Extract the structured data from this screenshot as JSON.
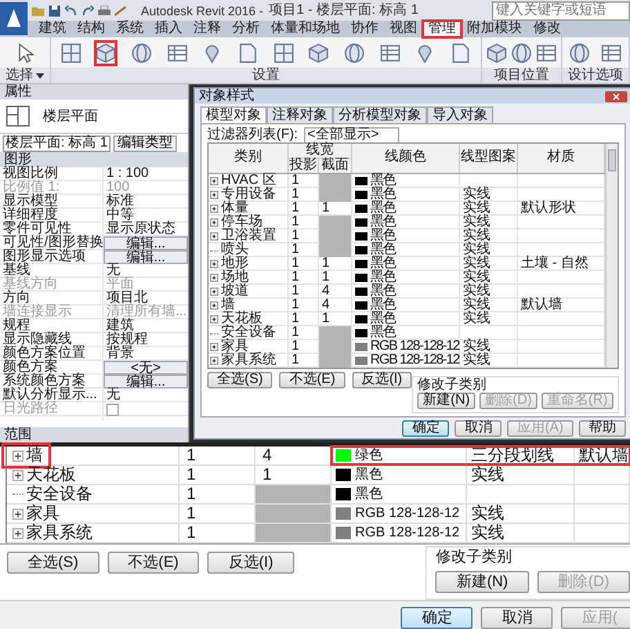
{
  "title_bar": {
    "app": "Autodesk Revit 2016 -",
    "document": "项目1 - 楼层平面: 标高 1",
    "search": {
      "placeholder": "键入关键字或短语"
    }
  },
  "ribbon_tabs": [
    {
      "label": "建筑",
      "selected": false,
      "annotated": false
    },
    {
      "label": "结构",
      "selected": false,
      "annotated": false
    },
    {
      "label": "系统",
      "selected": false,
      "annotated": false
    },
    {
      "label": "插入",
      "selected": false,
      "annotated": false
    },
    {
      "label": "注释",
      "selected": false,
      "annotated": false
    },
    {
      "label": "分析",
      "selected": false,
      "annotated": false
    },
    {
      "label": "体量和场地",
      "selected": false,
      "annotated": false
    },
    {
      "label": "协作",
      "selected": false,
      "annotated": false
    },
    {
      "label": "视图",
      "selected": false,
      "annotated": false
    },
    {
      "label": "管理",
      "selected": true,
      "annotated": true
    },
    {
      "label": "附加模块",
      "selected": false,
      "annotated": false
    },
    {
      "label": "修改",
      "selected": false,
      "annotated": false
    }
  ],
  "ribbon_groups": [
    {
      "label": "选择",
      "dropdown": true,
      "buttons": [
        {
          "annotated": false
        }
      ]
    },
    {
      "label": "设置",
      "dropdown": false,
      "buttons": [
        {
          "annotated": false
        },
        {
          "annotated": true
        },
        {
          "annotated": false
        },
        {
          "annotated": false
        },
        {
          "annotated": false
        },
        {
          "annotated": false
        },
        {
          "annotated": false
        },
        {
          "annotated": false
        },
        {
          "annotated": false
        },
        {
          "annotated": false
        },
        {
          "annotated": false
        },
        {
          "annotated": false
        }
      ]
    },
    {
      "label": "项目位置",
      "dropdown": false,
      "buttons": [
        {
          "annotated": false
        },
        {
          "annotated": false
        },
        {
          "annotated": false
        }
      ]
    },
    {
      "label": "设计选项",
      "dropdown": false,
      "buttons": [
        {
          "annotated": false
        },
        {
          "annotated": false
        }
      ]
    }
  ],
  "properties": {
    "title": "属性",
    "type_name": "楼层平面",
    "instance": "楼层平面: 标高 1",
    "edit_type": "编辑类型",
    "section": "图形",
    "footer": "范围",
    "rows": [
      {
        "label": "视图比例",
        "value": "1 : 100",
        "kind": "text",
        "disabled": false
      },
      {
        "label": "比例值 1:",
        "value": "100",
        "kind": "text",
        "disabled": true
      },
      {
        "label": "显示模型",
        "value": "标准",
        "kind": "text",
        "disabled": false
      },
      {
        "label": "详细程度",
        "value": "中等",
        "kind": "text",
        "disabled": false
      },
      {
        "label": "零件可见性",
        "value": "显示原状态",
        "kind": "text",
        "disabled": false
      },
      {
        "label": "可见性/图形替换",
        "value": "编辑...",
        "kind": "button",
        "disabled": false
      },
      {
        "label": "图形显示选项",
        "value": "编辑...",
        "kind": "button",
        "disabled": false
      },
      {
        "label": "基线",
        "value": "无",
        "kind": "text",
        "disabled": false
      },
      {
        "label": "基线方向",
        "value": "平面",
        "kind": "text",
        "disabled": true
      },
      {
        "label": "方向",
        "value": "项目北",
        "kind": "text",
        "disabled": false
      },
      {
        "label": "墙连接显示",
        "value": "清理所有墙...",
        "kind": "text",
        "disabled": true
      },
      {
        "label": "规程",
        "value": "建筑",
        "kind": "text",
        "disabled": false
      },
      {
        "label": "显示隐藏线",
        "value": "按规程",
        "kind": "text",
        "disabled": false
      },
      {
        "label": "颜色方案位置",
        "value": "背景",
        "kind": "text",
        "disabled": false
      },
      {
        "label": "颜色方案",
        "value": "<无>",
        "kind": "button",
        "disabled": false
      },
      {
        "label": "系统颜色方案",
        "value": "编辑...",
        "kind": "button",
        "disabled": false
      },
      {
        "label": "默认分析显示...",
        "value": "无",
        "kind": "text",
        "disabled": false
      },
      {
        "label": "日光路径",
        "kind": "checkbox",
        "checked": false,
        "disabled": true
      }
    ]
  },
  "dialog": {
    "title": "对象样式",
    "tabs": [
      {
        "label": "模型对象",
        "selected": true
      },
      {
        "label": "注释对象",
        "selected": false
      },
      {
        "label": "分析模型对象",
        "selected": false
      },
      {
        "label": "导入对象",
        "selected": false
      }
    ],
    "filter_label": "过滤器列表(F):",
    "filter_value": "<全部显示>",
    "columns": {
      "category": "类别",
      "line_weight": "线宽",
      "projection": "投影",
      "cut": "截面",
      "line_color": "线颜色",
      "line_pattern": "线型图案",
      "material": "材质"
    },
    "rows": [
      {
        "name": "HVAC 区",
        "expandable": true,
        "projection": "1",
        "color": "#000000",
        "color_name": "黑色"
      },
      {
        "name": "专用设备",
        "expandable": true,
        "projection": "1",
        "color": "#000000",
        "color_name": "黑色",
        "pattern": "实线"
      },
      {
        "name": "体量",
        "expandable": true,
        "projection": "1",
        "cut": "1",
        "color": "#000000",
        "color_name": "黑色",
        "pattern": "实线",
        "material": "默认形状"
      },
      {
        "name": "停车场",
        "expandable": true,
        "projection": "1",
        "color": "#000000",
        "color_name": "黑色",
        "pattern": "实线"
      },
      {
        "name": "卫浴装置",
        "expandable": true,
        "projection": "1",
        "color": "#000000",
        "color_name": "黑色",
        "pattern": "实线"
      },
      {
        "name": "喷头",
        "expandable": false,
        "projection": "1",
        "color": "#000000",
        "color_name": "黑色",
        "pattern": "实线"
      },
      {
        "name": "地形",
        "expandable": true,
        "projection": "1",
        "cut": "1",
        "color": "#000000",
        "color_name": "黑色",
        "pattern": "实线",
        "material": "土壤 - 自然"
      },
      {
        "name": "场地",
        "expandable": true,
        "projection": "1",
        "cut": "1",
        "color": "#000000",
        "color_name": "黑色",
        "pattern": "实线"
      },
      {
        "name": "坡道",
        "expandable": true,
        "projection": "1",
        "cut": "4",
        "color": "#000000",
        "color_name": "黑色",
        "pattern": "实线"
      },
      {
        "name": "墙",
        "expandable": true,
        "projection": "1",
        "cut": "4",
        "color": "#000000",
        "color_name": "黑色",
        "pattern": "实线",
        "material": "默认墙"
      },
      {
        "name": "天花板",
        "expandable": true,
        "projection": "1",
        "cut": "1",
        "color": "#000000",
        "color_name": "黑色",
        "pattern": "实线"
      },
      {
        "name": "安全设备",
        "expandable": false,
        "projection": "1",
        "color": "#000000",
        "color_name": "黑色"
      },
      {
        "name": "家具",
        "expandable": true,
        "projection": "1",
        "color": "#808080",
        "color_name": "RGB 128-128-12",
        "pattern": "实线"
      },
      {
        "name": "家具系统",
        "expandable": true,
        "projection": "1",
        "color": "#808080",
        "color_name": "RGB 128-128-12",
        "pattern": "实线"
      }
    ],
    "select_buttons": [
      "全选(S)",
      "不选(E)",
      "反选(I)"
    ],
    "subcategory": {
      "title": "修改子类别",
      "buttons": [
        {
          "label": "新建(N)",
          "disabled": false
        },
        {
          "label": "删除(D)",
          "disabled": true
        },
        {
          "label": "重命名(R)",
          "disabled": true
        }
      ]
    },
    "footer_buttons": [
      {
        "label": "确定",
        "default": true,
        "disabled": false
      },
      {
        "label": "取消",
        "default": false,
        "disabled": false
      },
      {
        "label": "应用(A)",
        "default": false,
        "disabled": true
      },
      {
        "label": "帮助",
        "default": false,
        "disabled": false
      }
    ]
  },
  "detail": {
    "rows": [
      {
        "name": "墙",
        "expandable": true,
        "annotated": true,
        "projection": "1",
        "cut": "4",
        "color": "#00ff00",
        "color_name": "绿色",
        "pattern": "三分段划线",
        "material": "默认墙"
      },
      {
        "name": "天花板",
        "expandable": true,
        "annotated": false,
        "projection": "1",
        "cut": "1",
        "color": "#000000",
        "color_name": "黑色",
        "pattern": "实线"
      },
      {
        "name": "安全设备",
        "expandable": false,
        "annotated": false,
        "projection": "1",
        "color": "#000000",
        "color_name": "黑色"
      },
      {
        "name": "家具",
        "expandable": true,
        "annotated": false,
        "projection": "1",
        "color": "#808080",
        "color_name": "RGB 128-128-12",
        "pattern": "实线"
      },
      {
        "name": "家具系统",
        "expandable": true,
        "annotated": false,
        "projection": "1",
        "color": "#808080",
        "color_name": "RGB 128-128-12",
        "pattern": "实线"
      }
    ],
    "select_buttons": [
      "全选(S)",
      "不选(E)",
      "反选(I)"
    ],
    "subcategory": {
      "title": "修改子类别",
      "buttons": [
        {
          "label": "新建(N)",
          "disabled": false
        },
        {
          "label": "删除(D)",
          "disabled": true
        }
      ]
    },
    "footer_buttons": [
      {
        "label": "确定",
        "default": true,
        "disabled": false
      },
      {
        "label": "取消",
        "default": false,
        "disabled": false
      },
      {
        "label": "应用(",
        "default": false,
        "disabled": true
      }
    ]
  }
}
